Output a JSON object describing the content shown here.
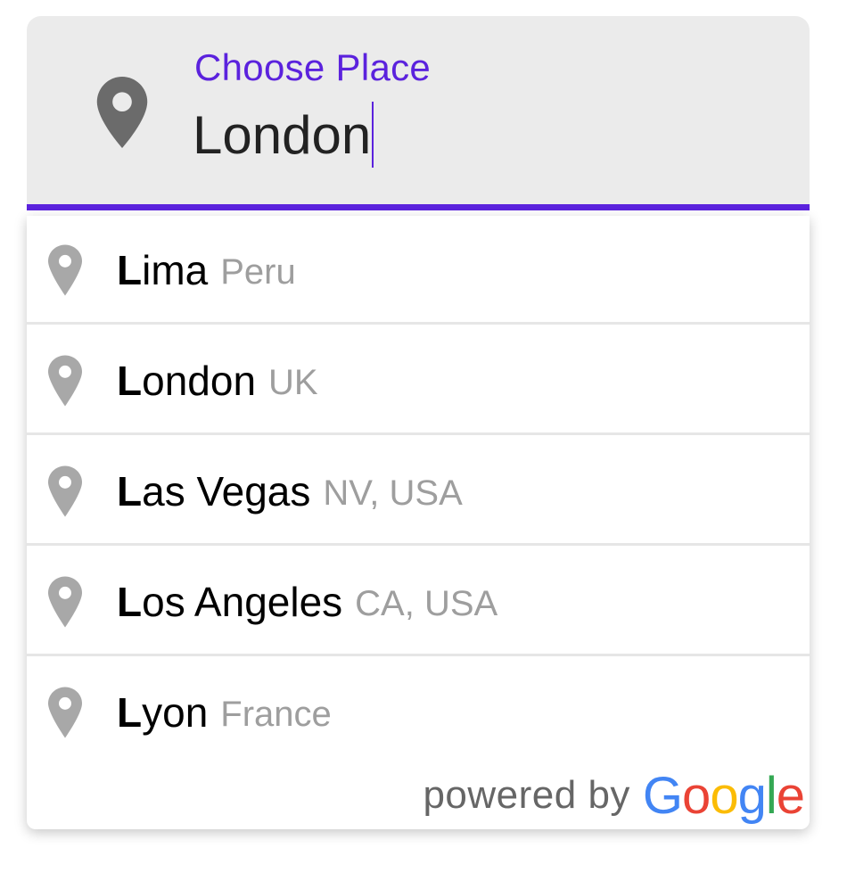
{
  "field": {
    "label": "Choose Place",
    "value": "London",
    "icon": "map-pin-icon",
    "accent_color": "#5b22dd"
  },
  "suggestions": [
    {
      "main_bold": "L",
      "main_rest": "ima",
      "secondary": "Peru",
      "icon": "map-pin-icon"
    },
    {
      "main_bold": "L",
      "main_rest": "ondon",
      "secondary": "UK",
      "icon": "map-pin-icon"
    },
    {
      "main_bold": "L",
      "main_rest": "as Vegas",
      "secondary": "NV, USA",
      "icon": "map-pin-icon"
    },
    {
      "main_bold": "L",
      "main_rest": "os Angeles",
      "secondary": "CA, USA",
      "icon": "map-pin-icon"
    },
    {
      "main_bold": "L",
      "main_rest": "yon",
      "secondary": "France",
      "icon": "map-pin-icon"
    }
  ],
  "attribution": {
    "text": "powered by",
    "brand_letters": [
      "G",
      "o",
      "o",
      "g",
      "l",
      "e"
    ],
    "brand_colors": [
      "#4285F4",
      "#EA4335",
      "#FBBC05",
      "#4285F4",
      "#34A853",
      "#EA4335"
    ]
  }
}
